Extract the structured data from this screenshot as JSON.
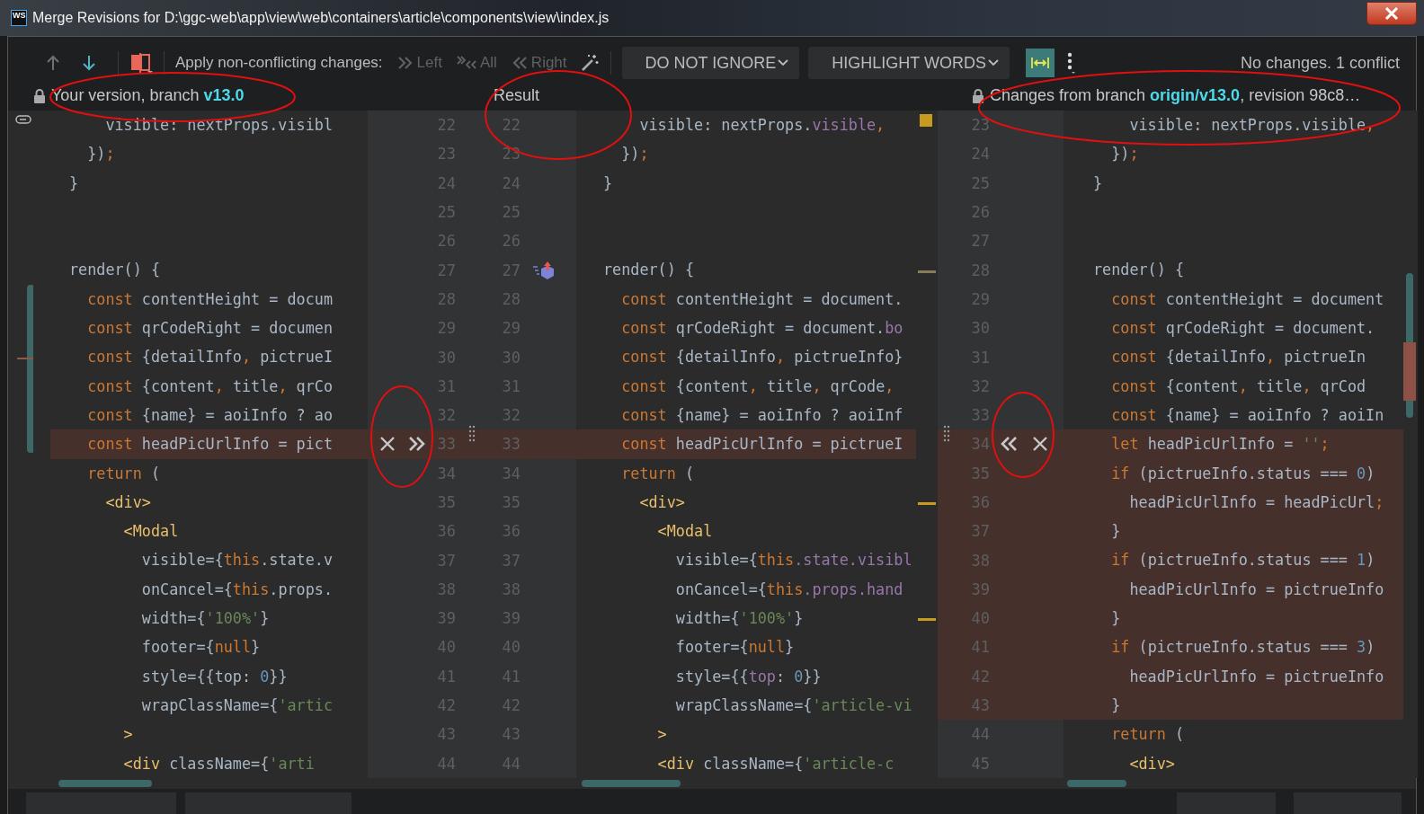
{
  "window": {
    "logo": "WS",
    "title": "Merge Revisions for D:\\ggc-web\\app\\view\\web\\containers\\article\\components\\view\\index.js"
  },
  "toolbar": {
    "nav_buttons": [
      {
        "kind": "up",
        "disabled": true
      },
      {
        "kind": "down",
        "disabled": false
      }
    ],
    "apply_label": "Apply non-conflicting changes:",
    "apply_buttons": [
      {
        "kind": "left",
        "label": "Left",
        "disabled": true
      },
      {
        "kind": "all",
        "label": "All",
        "disabled": true
      },
      {
        "kind": "right",
        "label": "Right",
        "disabled": true
      }
    ],
    "dropdowns": [
      {
        "label": "DO NOT IGNORE"
      },
      {
        "label": "HIGHLIGHT WORDS"
      }
    ],
    "sync_scroll": {
      "on": true
    },
    "status": "No changes. 1 conflict"
  },
  "headers": [
    {
      "text": "Your version, branch **v13.0**",
      "locked": true
    },
    {
      "text": "Result",
      "locked": false
    },
    {
      "text": "Changes from branch **origin/v13.0**, revision 98c8…",
      "locked": true
    }
  ],
  "panes": [
    {
      "lines": [
        {
          "tokens": [
            {
              "kind": "p",
              "text": "    visible: nextProps.visibl"
            }
          ],
          "conflict": false
        },
        {
          "tokens": [
            {
              "kind": "p",
              "text": "  })"
            },
            {
              "kind": "o",
              "text": ";"
            }
          ],
          "conflict": false
        },
        {
          "tokens": [
            {
              "kind": "p",
              "text": "}"
            }
          ],
          "conflict": false
        },
        {
          "conflict": false
        },
        {
          "conflict": false
        },
        {
          "tokens": [
            {
              "kind": "p",
              "text": "render() {"
            }
          ],
          "conflict": false
        },
        {
          "tokens": [
            {
              "kind": "k",
              "text": "  const"
            },
            {
              "kind": "p",
              "text": " contentHeight = docum"
            }
          ],
          "conflict": false
        },
        {
          "tokens": [
            {
              "kind": "k",
              "text": "  const"
            },
            {
              "kind": "p",
              "text": " qrCodeRight = documen"
            }
          ],
          "conflict": false
        },
        {
          "tokens": [
            {
              "kind": "k",
              "text": "  const"
            },
            {
              "kind": "p",
              "text": " {detailInfo"
            },
            {
              "kind": "o",
              "text": ","
            },
            {
              "kind": "p",
              "text": " pictrueI"
            }
          ],
          "conflict": false
        },
        {
          "tokens": [
            {
              "kind": "k",
              "text": "  const"
            },
            {
              "kind": "p",
              "text": " {content"
            },
            {
              "kind": "o",
              "text": ","
            },
            {
              "kind": "p",
              "text": " title"
            },
            {
              "kind": "o",
              "text": ","
            },
            {
              "kind": "p",
              "text": " qrCo"
            }
          ],
          "conflict": false
        },
        {
          "tokens": [
            {
              "kind": "k",
              "text": "  const"
            },
            {
              "kind": "p",
              "text": " {name} = aoiInfo ? ao"
            }
          ],
          "conflict": false
        },
        {
          "tokens": [
            {
              "kind": "k",
              "text": "  const"
            },
            {
              "kind": "p",
              "text": " headPicUrlInfo = pict"
            }
          ],
          "conflict": true
        },
        {
          "tokens": [
            {
              "kind": "k",
              "text": "  return"
            },
            {
              "kind": "p",
              "text": " ("
            }
          ],
          "conflict": false
        },
        {
          "tokens": [
            {
              "kind": "t",
              "text": "    <div>"
            }
          ],
          "conflict": false
        },
        {
          "tokens": [
            {
              "kind": "t",
              "text": "      <Modal"
            }
          ],
          "conflict": false
        },
        {
          "tokens": [
            {
              "kind": "p",
              "text": "        visible={"
            },
            {
              "kind": "k",
              "text": "this"
            },
            {
              "kind": "p",
              "text": ".state.v"
            }
          ],
          "conflict": false
        },
        {
          "tokens": [
            {
              "kind": "p",
              "text": "        onCancel={"
            },
            {
              "kind": "k",
              "text": "this"
            },
            {
              "kind": "p",
              "text": ".props."
            }
          ],
          "conflict": false
        },
        {
          "tokens": [
            {
              "kind": "p",
              "text": "        width={"
            },
            {
              "kind": "s",
              "text": "'100%'"
            },
            {
              "kind": "p",
              "text": "}"
            }
          ],
          "conflict": false
        },
        {
          "tokens": [
            {
              "kind": "p",
              "text": "        footer={"
            },
            {
              "kind": "k",
              "text": "null"
            },
            {
              "kind": "p",
              "text": "}"
            }
          ],
          "conflict": false
        },
        {
          "tokens": [
            {
              "kind": "p",
              "text": "        style={{top: "
            },
            {
              "kind": "n",
              "text": "0"
            },
            {
              "kind": "p",
              "text": "}}"
            }
          ],
          "conflict": false
        },
        {
          "tokens": [
            {
              "kind": "p",
              "text": "        wrapClassName={"
            },
            {
              "kind": "s",
              "text": "'artic"
            }
          ],
          "conflict": false
        },
        {
          "tokens": [
            {
              "kind": "t",
              "text": "      >"
            }
          ],
          "conflict": false
        },
        {
          "tokens": [
            {
              "kind": "t",
              "text": "      <div"
            },
            {
              "kind": "p",
              "text": " className={"
            },
            {
              "kind": "s",
              "text": "'arti"
            }
          ],
          "conflict": false
        }
      ]
    },
    {
      "lines": [
        {
          "tokens": [
            {
              "kind": "p",
              "text": "    visible: nextProps."
            },
            {
              "kind": "m",
              "text": "visible"
            },
            {
              "kind": "o",
              "text": ","
            }
          ],
          "conflict": false
        },
        {
          "tokens": [
            {
              "kind": "p",
              "text": "  })"
            },
            {
              "kind": "o",
              "text": ";"
            }
          ],
          "conflict": false
        },
        {
          "tokens": [
            {
              "kind": "p",
              "text": "}"
            }
          ],
          "conflict": false
        },
        {
          "conflict": false
        },
        {
          "conflict": false
        },
        {
          "tokens": [
            {
              "kind": "p",
              "text": "render() {"
            }
          ],
          "conflict": false
        },
        {
          "tokens": [
            {
              "kind": "k",
              "text": "  const"
            },
            {
              "kind": "p",
              "text": " contentHeight = document."
            }
          ],
          "conflict": false
        },
        {
          "tokens": [
            {
              "kind": "k",
              "text": "  const"
            },
            {
              "kind": "p",
              "text": " qrCodeRight = document."
            },
            {
              "kind": "m",
              "text": "bo"
            }
          ],
          "conflict": false
        },
        {
          "tokens": [
            {
              "kind": "k",
              "text": "  const"
            },
            {
              "kind": "p",
              "text": " {detailInfo"
            },
            {
              "kind": "o",
              "text": ","
            },
            {
              "kind": "p",
              "text": " pictrueInfo}"
            }
          ],
          "conflict": false
        },
        {
          "tokens": [
            {
              "kind": "k",
              "text": "  const"
            },
            {
              "kind": "p",
              "text": " {content"
            },
            {
              "kind": "o",
              "text": ","
            },
            {
              "kind": "p",
              "text": " title"
            },
            {
              "kind": "o",
              "text": ","
            },
            {
              "kind": "p",
              "text": " qrCode"
            },
            {
              "kind": "o",
              "text": ","
            }
          ],
          "conflict": false
        },
        {
          "tokens": [
            {
              "kind": "k",
              "text": "  const"
            },
            {
              "kind": "p",
              "text": " {name} = aoiInfo ? aoiInf"
            }
          ],
          "conflict": false
        },
        {
          "tokens": [
            {
              "kind": "k",
              "text": "  const"
            },
            {
              "kind": "p",
              "text": " headPicUrlInfo = pictrueI"
            }
          ],
          "conflict": true
        },
        {
          "tokens": [
            {
              "kind": "k",
              "text": "  return"
            },
            {
              "kind": "p",
              "text": " ("
            }
          ],
          "conflict": false
        },
        {
          "tokens": [
            {
              "kind": "t",
              "text": "    <div>"
            }
          ],
          "conflict": false
        },
        {
          "tokens": [
            {
              "kind": "t",
              "text": "      <Modal"
            }
          ],
          "conflict": false
        },
        {
          "tokens": [
            {
              "kind": "p",
              "text": "        visible={"
            },
            {
              "kind": "k",
              "text": "this"
            },
            {
              "kind": "m",
              "text": ".state.visibl"
            }
          ],
          "conflict": false
        },
        {
          "tokens": [
            {
              "kind": "p",
              "text": "        onCancel={"
            },
            {
              "kind": "k",
              "text": "this"
            },
            {
              "kind": "m",
              "text": ".props.hand"
            }
          ],
          "conflict": false
        },
        {
          "tokens": [
            {
              "kind": "p",
              "text": "        width={"
            },
            {
              "kind": "s",
              "text": "'100%'"
            },
            {
              "kind": "p",
              "text": "}"
            }
          ],
          "conflict": false
        },
        {
          "tokens": [
            {
              "kind": "p",
              "text": "        footer={"
            },
            {
              "kind": "k",
              "text": "null"
            },
            {
              "kind": "p",
              "text": "}"
            }
          ],
          "conflict": false
        },
        {
          "tokens": [
            {
              "kind": "p",
              "text": "        style={{"
            },
            {
              "kind": "m",
              "text": "top"
            },
            {
              "kind": "p",
              "text": ": "
            },
            {
              "kind": "n",
              "text": "0"
            },
            {
              "kind": "p",
              "text": "}}"
            }
          ],
          "conflict": false
        },
        {
          "tokens": [
            {
              "kind": "p",
              "text": "        wrapClassName={"
            },
            {
              "kind": "s",
              "text": "'article-vi"
            }
          ],
          "conflict": false
        },
        {
          "tokens": [
            {
              "kind": "t",
              "text": "      >"
            }
          ],
          "conflict": false
        },
        {
          "tokens": [
            {
              "kind": "t",
              "text": "      <div"
            },
            {
              "kind": "p",
              "text": " className={"
            },
            {
              "kind": "s",
              "text": "'article-c"
            }
          ],
          "conflict": false
        }
      ]
    },
    {
      "lines": [
        {
          "tokens": [
            {
              "kind": "p",
              "text": "    visible: nextProps.visible"
            },
            {
              "kind": "o",
              "text": ","
            }
          ],
          "conflict": false
        },
        {
          "tokens": [
            {
              "kind": "p",
              "text": "  })"
            },
            {
              "kind": "o",
              "text": ";"
            }
          ],
          "conflict": false
        },
        {
          "tokens": [
            {
              "kind": "p",
              "text": "}"
            }
          ],
          "conflict": false
        },
        {
          "conflict": false
        },
        {
          "conflict": false
        },
        {
          "tokens": [
            {
              "kind": "p",
              "text": "render() {"
            }
          ],
          "conflict": false
        },
        {
          "tokens": [
            {
              "kind": "k",
              "text": "  const"
            },
            {
              "kind": "p",
              "text": " contentHeight = document"
            }
          ],
          "conflict": false
        },
        {
          "tokens": [
            {
              "kind": "k",
              "text": "  const"
            },
            {
              "kind": "p",
              "text": " qrCodeRight = document."
            }
          ],
          "conflict": false
        },
        {
          "tokens": [
            {
              "kind": "k",
              "text": "  const"
            },
            {
              "kind": "p",
              "text": " {detailInfo"
            },
            {
              "kind": "o",
              "text": ","
            },
            {
              "kind": "p",
              "text": " pictrueIn"
            }
          ],
          "conflict": false
        },
        {
          "tokens": [
            {
              "kind": "k",
              "text": "  const"
            },
            {
              "kind": "p",
              "text": " {content"
            },
            {
              "kind": "o",
              "text": ","
            },
            {
              "kind": "p",
              "text": " title"
            },
            {
              "kind": "o",
              "text": ","
            },
            {
              "kind": "p",
              "text": " qrCod"
            }
          ],
          "conflict": false
        },
        {
          "tokens": [
            {
              "kind": "k",
              "text": "  const"
            },
            {
              "kind": "p",
              "text": " {name} = aoiInfo ? aoiIn"
            }
          ],
          "conflict": false
        },
        {
          "tokens": [
            {
              "kind": "k",
              "text": "  let"
            },
            {
              "kind": "p",
              "text": " headPicUrlInfo = "
            },
            {
              "kind": "s",
              "text": "''"
            },
            {
              "kind": "o",
              "text": ";"
            }
          ],
          "conflict": true
        },
        {
          "tokens": [
            {
              "kind": "k",
              "text": "  if"
            },
            {
              "kind": "p",
              "text": " (pictrueInfo.status === "
            },
            {
              "kind": "n",
              "text": "0"
            },
            {
              "kind": "p",
              "text": ")"
            }
          ],
          "conflict": true
        },
        {
          "tokens": [
            {
              "kind": "p",
              "text": "    headPicUrlInfo = headPicUrl"
            },
            {
              "kind": "o",
              "text": ";"
            }
          ],
          "conflict": true
        },
        {
          "tokens": [
            {
              "kind": "p",
              "text": "  }"
            }
          ],
          "conflict": true
        },
        {
          "tokens": [
            {
              "kind": "k",
              "text": "  if"
            },
            {
              "kind": "p",
              "text": " (pictrueInfo.status === "
            },
            {
              "kind": "n",
              "text": "1"
            },
            {
              "kind": "p",
              "text": ")"
            }
          ],
          "conflict": true
        },
        {
          "tokens": [
            {
              "kind": "p",
              "text": "    headPicUrlInfo = pictrueInfo"
            }
          ],
          "conflict": true
        },
        {
          "tokens": [
            {
              "kind": "p",
              "text": "  }"
            }
          ],
          "conflict": true
        },
        {
          "tokens": [
            {
              "kind": "k",
              "text": "  if"
            },
            {
              "kind": "p",
              "text": " (pictrueInfo.status === "
            },
            {
              "kind": "n",
              "text": "3"
            },
            {
              "kind": "p",
              "text": ")"
            }
          ],
          "conflict": true
        },
        {
          "tokens": [
            {
              "kind": "p",
              "text": "    headPicUrlInfo = pictrueInfo"
            }
          ],
          "conflict": true
        },
        {
          "tokens": [
            {
              "kind": "p",
              "text": "  }"
            }
          ],
          "conflict": true
        },
        {
          "tokens": [
            {
              "kind": "k",
              "text": "  return"
            },
            {
              "kind": "p",
              "text": " ("
            }
          ],
          "conflict": false
        },
        {
          "tokens": [
            {
              "kind": "t",
              "text": "    <div>"
            }
          ],
          "conflict": false
        }
      ]
    }
  ],
  "gutters": [
    {
      "rows": [
        {
          "numbers": [
            "22",
            "22"
          ],
          "conflict": false
        },
        {
          "numbers": [
            "23",
            "23"
          ],
          "conflict": false
        },
        {
          "numbers": [
            "24",
            "24"
          ],
          "conflict": false
        },
        {
          "numbers": [
            "25",
            "25"
          ],
          "conflict": false
        },
        {
          "numbers": [
            "26",
            "26"
          ],
          "conflict": false
        },
        {
          "numbers": [
            "27",
            "27"
          ],
          "actions": [
            {
              "kind": "resolve"
            }
          ],
          "conflict": false
        },
        {
          "numbers": [
            "28",
            "28"
          ],
          "conflict": false
        },
        {
          "numbers": [
            "29",
            "29"
          ],
          "conflict": false
        },
        {
          "numbers": [
            "30",
            "30"
          ],
          "conflict": false
        },
        {
          "numbers": [
            "31",
            "31"
          ],
          "conflict": false
        },
        {
          "numbers": [
            "32",
            "32"
          ],
          "conflict": false
        },
        {
          "numbers": [
            "33",
            "33"
          ],
          "actions": [
            {
              "kind": "discard"
            },
            {
              "kind": "accept_right"
            }
          ],
          "conflict": true
        },
        {
          "numbers": [
            "34",
            "34"
          ],
          "conflict": false
        },
        {
          "numbers": [
            "35",
            "35"
          ],
          "conflict": false
        },
        {
          "numbers": [
            "36",
            "36"
          ],
          "conflict": false
        },
        {
          "numbers": [
            "37",
            "37"
          ],
          "conflict": false
        },
        {
          "numbers": [
            "38",
            "38"
          ],
          "conflict": false
        },
        {
          "numbers": [
            "39",
            "39"
          ],
          "conflict": false
        },
        {
          "numbers": [
            "40",
            "40"
          ],
          "conflict": false
        },
        {
          "numbers": [
            "41",
            "41"
          ],
          "conflict": false
        },
        {
          "numbers": [
            "42",
            "42"
          ],
          "conflict": false
        },
        {
          "numbers": [
            "43",
            "43"
          ],
          "conflict": false
        },
        {
          "numbers": [
            "44",
            "44"
          ],
          "conflict": false
        }
      ]
    },
    {
      "rows": [
        {
          "numbers": [
            "23"
          ],
          "conflict": false
        },
        {
          "numbers": [
            "24"
          ],
          "conflict": false
        },
        {
          "numbers": [
            "25"
          ],
          "conflict": false
        },
        {
          "numbers": [
            "26"
          ],
          "conflict": false
        },
        {
          "numbers": [
            "27"
          ],
          "conflict": false
        },
        {
          "numbers": [
            "28"
          ],
          "conflict": false
        },
        {
          "numbers": [
            "29"
          ],
          "conflict": false
        },
        {
          "numbers": [
            "30"
          ],
          "conflict": false
        },
        {
          "numbers": [
            "31"
          ],
          "conflict": false
        },
        {
          "numbers": [
            "32"
          ],
          "conflict": false
        },
        {
          "numbers": [
            "33"
          ],
          "conflict": false
        },
        {
          "numbers": [
            "34"
          ],
          "actions": [
            {
              "kind": "accept_left"
            },
            {
              "kind": "discard"
            }
          ],
          "conflict": true
        },
        {
          "numbers": [
            "35"
          ],
          "conflict": true
        },
        {
          "numbers": [
            "36"
          ],
          "conflict": true
        },
        {
          "numbers": [
            "37"
          ],
          "conflict": true
        },
        {
          "numbers": [
            "38"
          ],
          "conflict": true
        },
        {
          "numbers": [
            "39"
          ],
          "conflict": true
        },
        {
          "numbers": [
            "40"
          ],
          "conflict": true
        },
        {
          "numbers": [
            "41"
          ],
          "conflict": true
        },
        {
          "numbers": [
            "42"
          ],
          "conflict": true
        },
        {
          "numbers": [
            "43"
          ],
          "conflict": true
        },
        {
          "numbers": [
            "44"
          ],
          "conflict": false
        },
        {
          "numbers": [
            "45"
          ],
          "conflict": false
        }
      ]
    }
  ]
}
